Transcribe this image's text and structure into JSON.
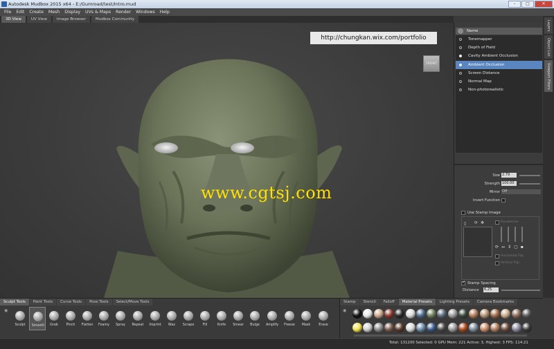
{
  "window": {
    "title": "Autodesk Mudbox 2015 x64 - E:/Gumroad/test/Intro.mud",
    "min": "–",
    "max": "□",
    "close": "✕"
  },
  "menu": [
    "File",
    "Edit",
    "Create",
    "Mesh",
    "Display",
    "UVs & Maps",
    "Render",
    "Windows",
    "Help"
  ],
  "view_tabs": [
    "3D View",
    "UV View",
    "Image Browser",
    "Mudbox Community"
  ],
  "viewport": {
    "url_banner": "http://chungkan.wix.com/portfolio",
    "viewcube_label": "FRONT",
    "watermark": "www.cgtsj.com"
  },
  "side_tabs": [
    "Layers",
    "Object List",
    "Viewport Filters"
  ],
  "filters": {
    "header": "Name",
    "items": [
      {
        "label": "Tonemapper",
        "on": false
      },
      {
        "label": "Depth of Field",
        "on": false
      },
      {
        "label": "Cavity Ambient Occlusion",
        "on": true
      },
      {
        "label": "Ambient Occlusion",
        "on": true,
        "selected": true
      },
      {
        "label": "Screen Distance",
        "on": false
      },
      {
        "label": "Normal Map",
        "on": false
      },
      {
        "label": "Non-photorealistic",
        "on": false
      }
    ]
  },
  "properties": {
    "size_label": "Size",
    "size_value": "2.79",
    "strength_label": "Strength",
    "strength_value": "100.00",
    "mirror_label": "Mirror",
    "mirror_value": "Off",
    "invert_label": "Invert Function",
    "stamp_image_label": "Use Stamp Image",
    "randomize_label": "Randomize",
    "hflip_label": "Horizontal Flip",
    "vflip_label": "Vertical Flip",
    "stamp_spacing_label": "Stamp Spacing",
    "distance_label": "Distance",
    "distance_value": "6.25"
  },
  "shelf_tabs_left": [
    "Sculpt Tools",
    "Paint Tools",
    "Curve Tools",
    "Pose Tools",
    "Select/Move Tools"
  ],
  "sculpt_tools": [
    "Sculpt",
    "Smooth",
    "Grab",
    "Pinch",
    "Flatten",
    "Foamy",
    "Spray",
    "Repeat",
    "Imprint",
    "Wax",
    "Scrape",
    "Fill",
    "Knife",
    "Smear",
    "Bulge",
    "Amplify",
    "Freeze",
    "Mask",
    "Erase"
  ],
  "shelf_tabs_right": [
    "Stamp",
    "Stencil",
    "Falloff",
    "Material Presets",
    "Lighting Presets",
    "Camera Bookmarks"
  ],
  "material_colors_row1": [
    "#111111",
    "#e8e8e8",
    "#c9a48a",
    "#8b3a2e",
    "#2a2a2a",
    "#d9d9d9",
    "#4c6a8a",
    "#6e7e5a",
    "#5a6a7a",
    "#9a9a9a",
    "#3a4a3a",
    "#b07c5a",
    "#b0916f",
    "#9c6a4a",
    "#c7a98a",
    "#8a6a5a",
    "#5a5a5a"
  ],
  "material_colors_row2": [
    "#f2e24a",
    "#cfcfcf",
    "#8a8a8a",
    "#7a5a4a",
    "#5a3a2a",
    "#d8d8d8",
    "#6a8aa8",
    "#3a5a8a",
    "#4a4a4a",
    "#9a9a9a",
    "#a8481e",
    "#7a8a9a",
    "#c58a6a",
    "#aa7a5a",
    "#6a4a3a",
    "#8a8aa0",
    "#3a3a3a"
  ],
  "status": "Total: 131200   Selected: 0 GPU Mem: 221   Active: 3, Highest: 3   FPS: 114.21"
}
